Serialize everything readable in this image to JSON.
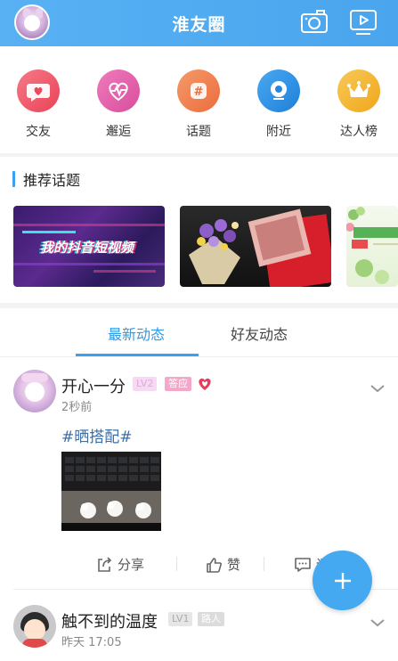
{
  "header": {
    "title": "淮友圈",
    "avatar_icon": "user-avatar",
    "camera_icon": "camera-icon",
    "video_icon": "video-icon",
    "accent": "#4aa5ee"
  },
  "menu": {
    "items": [
      {
        "label": "交友",
        "icon": "heart-chat-icon",
        "color": "#f0566a"
      },
      {
        "label": "邂逅",
        "icon": "heartbeat-icon",
        "color": "#e65aa8"
      },
      {
        "label": "话题",
        "icon": "hashtag-icon",
        "color": "#f0794a"
      },
      {
        "label": "附近",
        "icon": "location-icon",
        "color": "#2f8fe5"
      },
      {
        "label": "达人榜",
        "icon": "crown-icon",
        "color": "#f3b52a"
      }
    ]
  },
  "recommended": {
    "title": "推荐话题",
    "cards": [
      {
        "caption": "我的抖音短视频",
        "icon": "video-cover-image"
      },
      {
        "icon": "flowers-money-image"
      },
      {
        "icon": "spring-card-image"
      }
    ]
  },
  "tabs": [
    {
      "label": "最新动态",
      "active": true
    },
    {
      "label": "好友动态",
      "active": false
    }
  ],
  "posts": [
    {
      "username": "开心一分",
      "level": "LV2",
      "role": "答应",
      "time": "2秒前",
      "hashtag": "#晒搭配#",
      "actions": {
        "share": "分享",
        "like": "赞",
        "comment": "评"
      }
    },
    {
      "username": "触不到的温度",
      "level": "LV1",
      "role": "路人",
      "time": "昨天 17:05"
    }
  ],
  "fab": {
    "icon": "plus-icon"
  }
}
